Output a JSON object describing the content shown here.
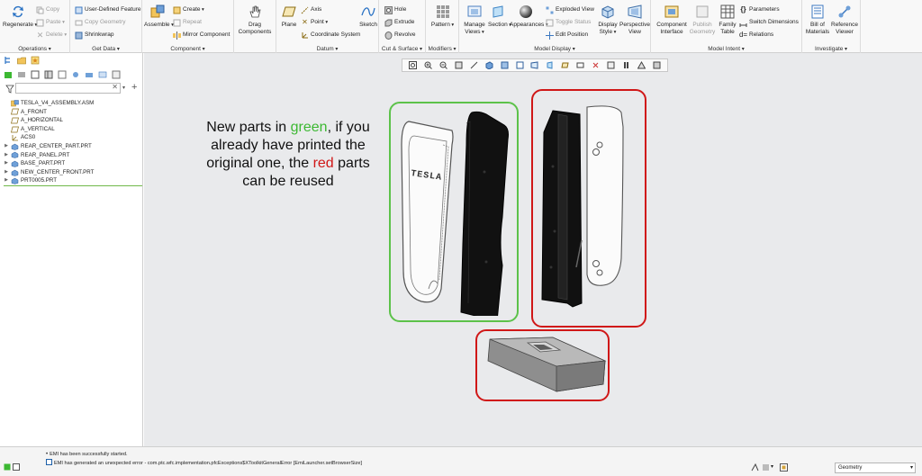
{
  "ribbon": {
    "operations": {
      "title": "Operations",
      "regenerate": "Regenerate",
      "copy": "Copy",
      "paste": "Paste",
      "delete": "Delete"
    },
    "get_data": {
      "title": "Get Data",
      "user_defined_feature": "User-Defined Feature",
      "copy_geometry": "Copy Geometry",
      "shrinkwrap": "Shrinkwrap"
    },
    "component": {
      "title": "Component",
      "assemble": "Assemble",
      "create": "Create",
      "repeat": "Repeat",
      "mirror_component": "Mirror Component",
      "drag_components_1": "Drag",
      "drag_components_2": "Components"
    },
    "datum": {
      "title": "Datum",
      "plane": "Plane",
      "axis": "Axis",
      "point": "Point",
      "coordinate_system": "Coordinate System",
      "sketch": "Sketch"
    },
    "cut_surface": {
      "title": "Cut & Surface",
      "hole": "Hole",
      "extrude": "Extrude",
      "revolve": "Revolve"
    },
    "modifiers": {
      "title": "Modifiers",
      "pattern": "Pattern"
    },
    "model_display": {
      "title": "Model Display",
      "manage_views_1": "Manage",
      "manage_views_2": "Views",
      "section": "Section",
      "appearances": "Appearances",
      "exploded_view": "Exploded View",
      "toggle_status": "Toggle Status",
      "edit_position": "Edit Position",
      "display_style_1": "Display",
      "display_style_2": "Style",
      "perspective_view_1": "Perspective",
      "perspective_view_2": "View"
    },
    "model_intent": {
      "title": "Model Intent",
      "component_interface_1": "Component",
      "component_interface_2": "Interface",
      "publish_geometry_1": "Publish",
      "publish_geometry_2": "Geometry",
      "family_table_1": "Family",
      "family_table_2": "Table",
      "parameters": "Parameters",
      "switch_dimensions": "Switch Dimensions",
      "relations": "Relations"
    },
    "investigate": {
      "title": "Investigate",
      "bill_of_materials_1": "Bill of",
      "bill_of_materials_2": "Materials",
      "reference_viewer_1": "Reference",
      "reference_viewer_2": "Viewer"
    }
  },
  "model_tree": {
    "items": [
      {
        "label": "TESLA_V4_ASSEMBLY.ASM",
        "icon": "assembly-icon",
        "expandable": false
      },
      {
        "label": "A_FRONT",
        "icon": "datum-plane-icon",
        "expandable": false
      },
      {
        "label": "A_HORIZONTAL",
        "icon": "datum-plane-icon",
        "expandable": false
      },
      {
        "label": "A_VERTICAL",
        "icon": "datum-plane-icon",
        "expandable": false
      },
      {
        "label": "ACS0",
        "icon": "coordinate-system-icon",
        "expandable": false
      },
      {
        "label": "REAR_CENTER_PART.PRT",
        "icon": "part-icon",
        "expandable": true
      },
      {
        "label": "REAR_PANEL.PRT",
        "icon": "part-icon",
        "expandable": true
      },
      {
        "label": "BASE_PART.PRT",
        "icon": "part-icon",
        "expandable": true
      },
      {
        "label": "NEW_CENTER_FRONT.PRT",
        "icon": "part-icon",
        "expandable": true
      },
      {
        "label": "PRT0005.PRT",
        "icon": "part-icon",
        "expandable": true
      }
    ]
  },
  "canvas": {
    "note_part1": "New parts in ",
    "note_green": "green",
    "note_part2": ", if you already have printed the original one, the ",
    "note_red": "red",
    "note_part3": " parts can be reused",
    "brand_text": "TESLA",
    "colors": {
      "green_frame": "#5cc24a",
      "red_frame": "#d01717",
      "background": "#e9eaec"
    }
  },
  "status": {
    "message_1": "EMI has been successfully started.",
    "message_2": "EMI has generated an unexpected error - com.ptc.wfc.implementation.pfcExceptions$XToolkitGeneralError [EmiLauncher.setBrowserSize]",
    "filter_value": "Geometry"
  }
}
